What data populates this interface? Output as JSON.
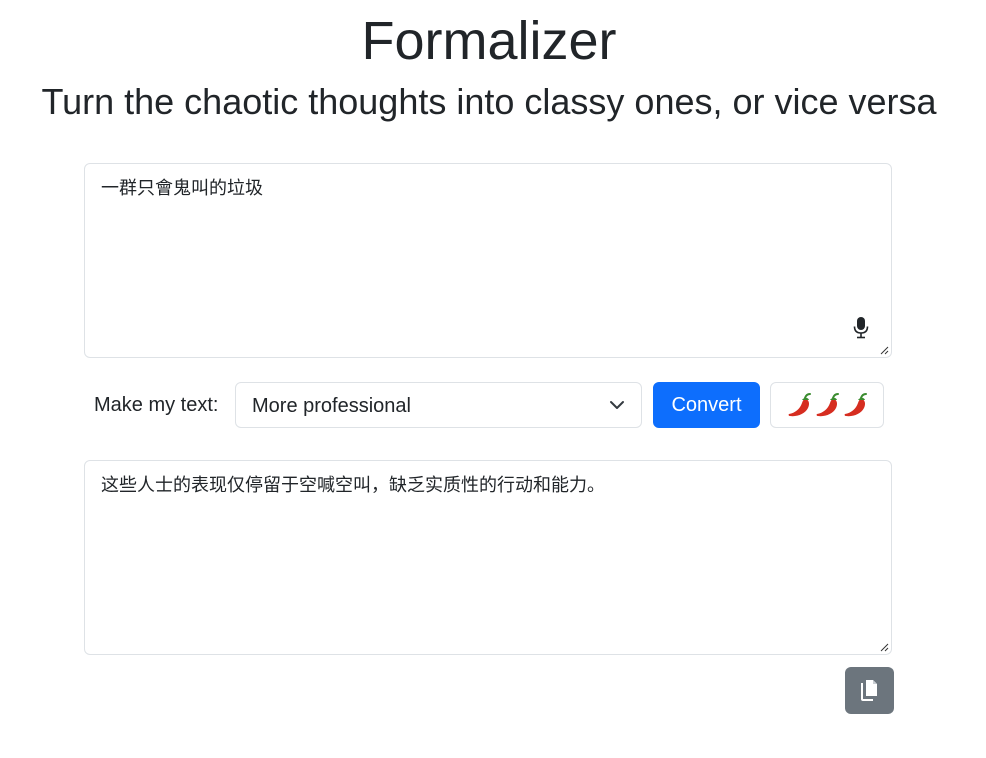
{
  "header": {
    "title": "Formalizer",
    "subtitle": "Turn the chaotic thoughts into classy ones, or vice versa"
  },
  "input": {
    "text": "一群只會鬼叫的垃圾",
    "mic_icon": "microphone-icon"
  },
  "controls": {
    "label": "Make my text:",
    "mode_selected": "More professional",
    "convert_label": "Convert",
    "spice_icon": "chili-pepper-icon",
    "spice_level": 3
  },
  "output": {
    "text": "这些人士的表现仅停留于空喊空叫，缺乏实质性的行动和能力。",
    "copy_icon": "copy-icon"
  },
  "colors": {
    "primary": "#0d6efd",
    "secondary": "#6c757d",
    "border": "#dee2e6",
    "text": "#212529",
    "pepper_red": "#d62d20",
    "pepper_green": "#3a8c2f"
  }
}
